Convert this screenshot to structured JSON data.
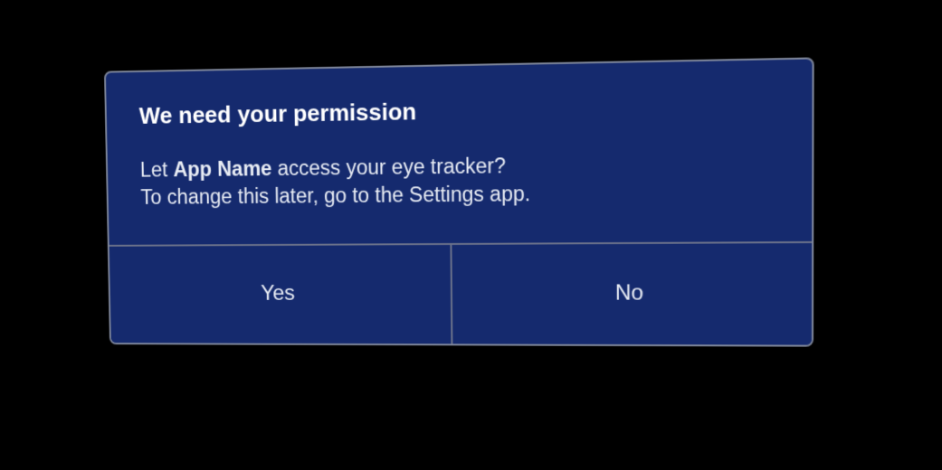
{
  "dialog": {
    "title": "We need your permission",
    "body": {
      "line1_prefix": "Let ",
      "app_name": "App Name",
      "line1_suffix": " access your eye tracker?",
      "line2": "To change this later, go to the Settings app."
    },
    "actions": {
      "yes_label": "Yes",
      "no_label": "No"
    }
  }
}
